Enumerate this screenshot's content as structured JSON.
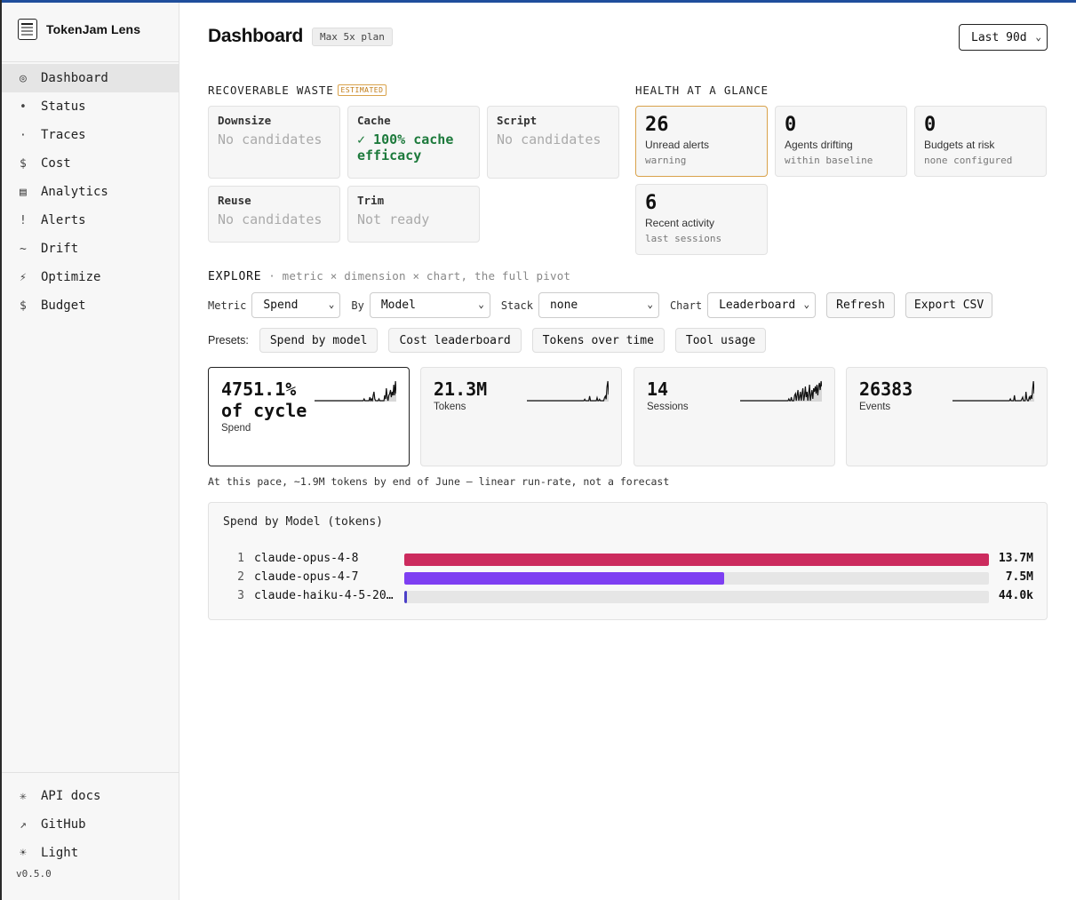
{
  "app": {
    "name": "TokenJam Lens",
    "version": "v0.5.0"
  },
  "sidebar": {
    "items": [
      {
        "icon": "◎",
        "label": "Dashboard",
        "active": true
      },
      {
        "icon": "•",
        "label": "Status"
      },
      {
        "icon": "·",
        "label": "Traces"
      },
      {
        "icon": "$",
        "label": "Cost"
      },
      {
        "icon": "▤",
        "label": "Analytics"
      },
      {
        "icon": "!",
        "label": "Alerts"
      },
      {
        "icon": "~",
        "label": "Drift"
      },
      {
        "icon": "⚡",
        "label": "Optimize"
      },
      {
        "icon": "$",
        "label": "Budget"
      }
    ],
    "footer": [
      {
        "icon": "✳",
        "label": "API docs"
      },
      {
        "icon": "↗",
        "label": "GitHub"
      },
      {
        "icon": "☀",
        "label": "Light"
      }
    ]
  },
  "header": {
    "title": "Dashboard",
    "plan": "Max 5x plan",
    "range": "Last 90d"
  },
  "waste": {
    "label": "RECOVERABLE WASTE",
    "badge": "ESTIMATED",
    "cards": [
      {
        "title": "Downsize",
        "value": "No candidates"
      },
      {
        "title": "Cache",
        "value": "✓ 100% cache efficacy"
      },
      {
        "title": "Script",
        "value": "No candidates"
      },
      {
        "title": "Reuse",
        "value": "No candidates"
      },
      {
        "title": "Trim",
        "value": "Not ready"
      }
    ]
  },
  "health": {
    "label": "HEALTH AT A GLANCE",
    "cards": [
      {
        "value": "26",
        "label": "Unread alerts",
        "sub": "warning"
      },
      {
        "value": "0",
        "label": "Agents drifting",
        "sub": "within baseline"
      },
      {
        "value": "0",
        "label": "Budgets at risk",
        "sub": "none configured"
      },
      {
        "value": "6",
        "label": "Recent activity",
        "sub": "last sessions"
      }
    ]
  },
  "explore": {
    "label": "EXPLORE",
    "sub": "· metric × dimension × chart, the full pivot",
    "metric_label": "Metric",
    "metric": "Spend",
    "by_label": "By",
    "by": "Model",
    "stack_label": "Stack",
    "stack": "none",
    "chart_label": "Chart",
    "chart": "Leaderboard",
    "refresh": "Refresh",
    "export": "Export CSV",
    "presets_label": "Presets:",
    "presets": [
      "Spend by model",
      "Cost leaderboard",
      "Tokens over time",
      "Tool usage"
    ]
  },
  "metrics": [
    {
      "value": "4751.1% of cycle",
      "label": "Spend",
      "spark": [
        0,
        0,
        0,
        0,
        0,
        0,
        0,
        0,
        0,
        0,
        0,
        0,
        0,
        0,
        0,
        0,
        0,
        0,
        0,
        0,
        0,
        0,
        0,
        0,
        0,
        0,
        0,
        0,
        0,
        0,
        0,
        0,
        0,
        0,
        0,
        0,
        0,
        0,
        0,
        0,
        0,
        0,
        0,
        0,
        0,
        0,
        0,
        0,
        0,
        0,
        0,
        0,
        0,
        0,
        0,
        0,
        0,
        0,
        0,
        0,
        1,
        0,
        0,
        0,
        0,
        0,
        0,
        2,
        0,
        1,
        0,
        3,
        5,
        1,
        0,
        0,
        0,
        0,
        1,
        0,
        0,
        0,
        0,
        0,
        0,
        3,
        1,
        7,
        2,
        0,
        3,
        4,
        6,
        2,
        5,
        3,
        9,
        3,
        11,
        4
      ]
    },
    {
      "value": "21.3M",
      "label": "Tokens",
      "spark": [
        0,
        0,
        0,
        0,
        0,
        0,
        0,
        0,
        0,
        0,
        0,
        0,
        0,
        0,
        0,
        0,
        0,
        0,
        0,
        0,
        0,
        0,
        0,
        0,
        0,
        0,
        0,
        0,
        0,
        0,
        0,
        0,
        0,
        0,
        0,
        0,
        0,
        0,
        0,
        0,
        0,
        0,
        0,
        0,
        0,
        0,
        0,
        0,
        0,
        0,
        0,
        0,
        0,
        0,
        0,
        0,
        0,
        0,
        0,
        0,
        0,
        0,
        0,
        0,
        0,
        0,
        0,
        0,
        0,
        0,
        1,
        0,
        0,
        0,
        0,
        0,
        3,
        0,
        0,
        0,
        0,
        0,
        0,
        0,
        0,
        2,
        0,
        0,
        1,
        0,
        0,
        0,
        0,
        0,
        2,
        3,
        1,
        9,
        13,
        4
      ]
    },
    {
      "value": "14",
      "label": "Sessions",
      "spark": [
        0,
        0,
        0,
        0,
        0,
        0,
        0,
        0,
        0,
        0,
        0,
        0,
        0,
        0,
        0,
        0,
        0,
        0,
        0,
        0,
        0,
        0,
        0,
        0,
        0,
        0,
        0,
        0,
        0,
        0,
        0,
        0,
        0,
        0,
        0,
        0,
        0,
        0,
        0,
        0,
        0,
        0,
        0,
        0,
        0,
        0,
        0,
        0,
        0,
        0,
        0,
        0,
        0,
        0,
        0,
        0,
        0,
        0,
        0,
        1,
        0,
        0,
        2,
        0,
        0,
        0,
        3,
        4,
        0,
        3,
        6,
        0,
        2,
        5,
        0,
        4,
        7,
        0,
        3,
        8,
        2,
        5,
        0,
        4,
        9,
        0,
        3,
        6,
        1,
        7,
        5,
        8,
        4,
        9,
        3,
        8,
        10,
        6,
        11,
        8
      ]
    },
    {
      "value": "26383",
      "label": "Events",
      "spark": [
        0,
        0,
        0,
        0,
        0,
        0,
        0,
        0,
        0,
        0,
        0,
        0,
        0,
        0,
        0,
        0,
        0,
        0,
        0,
        0,
        0,
        0,
        0,
        0,
        0,
        0,
        0,
        0,
        0,
        0,
        0,
        0,
        0,
        0,
        0,
        0,
        0,
        0,
        0,
        0,
        0,
        0,
        0,
        0,
        0,
        0,
        0,
        0,
        0,
        0,
        0,
        0,
        0,
        0,
        0,
        0,
        0,
        0,
        0,
        0,
        0,
        0,
        0,
        0,
        0,
        0,
        0,
        0,
        0,
        0,
        1,
        0,
        0,
        0,
        0,
        3,
        0,
        0,
        0,
        0,
        0,
        0,
        0,
        0,
        1,
        2,
        0,
        0,
        0,
        5,
        1,
        0,
        0,
        2,
        1,
        3,
        1,
        6,
        11,
        4
      ]
    }
  ],
  "runrate": "At this pace, ~1.9M tokens by end of June — linear run-rate, not a forecast",
  "leaderboard": {
    "title": "Spend by Model (tokens)",
    "max": 13.7,
    "rows": [
      {
        "rank": "1",
        "model": "claude-opus-4-8",
        "label": "13.7M",
        "value": 13.7,
        "color": "#cc2b5e"
      },
      {
        "rank": "2",
        "model": "claude-opus-4-7",
        "label": "7.5M",
        "value": 7.5,
        "color": "#7e3ff2"
      },
      {
        "rank": "3",
        "model": "claude-haiku-4-5-20…",
        "label": "44.0k",
        "value": 0.044,
        "color": "#4b3fc8"
      }
    ]
  }
}
